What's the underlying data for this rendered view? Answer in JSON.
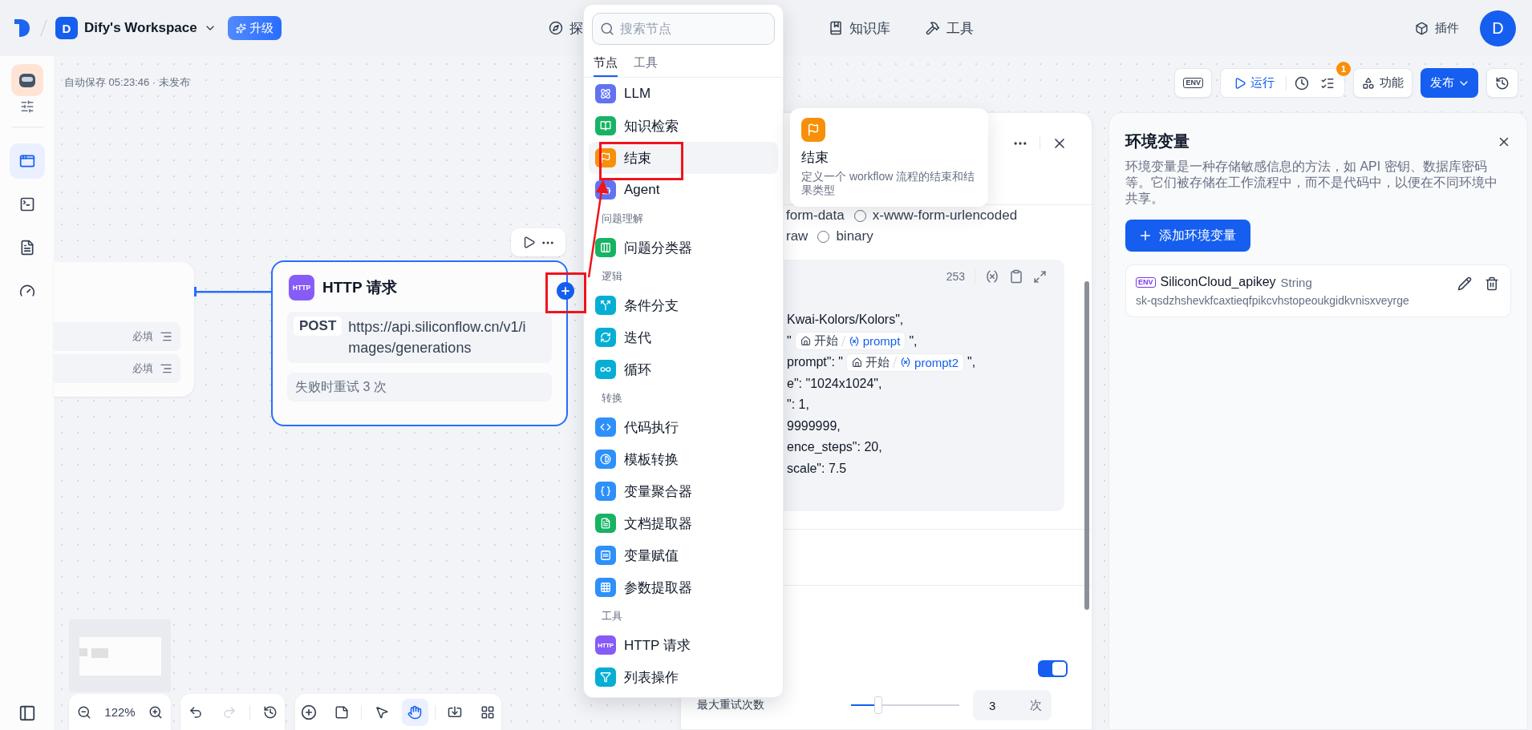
{
  "top_bar": {
    "workspace_initial": "D",
    "workspace_name": "Dify's Workspace",
    "upgrade_label": "升级",
    "nav": [
      {
        "label": "探"
      },
      {
        "label": "知识库"
      },
      {
        "label": "工具"
      }
    ],
    "plugins_label": "插件",
    "avatar_initial": "D"
  },
  "sidebar": {
    "items": [
      {
        "selected": true
      },
      {
        "selected": false
      },
      {
        "selected": false
      },
      {
        "selected": false
      }
    ]
  },
  "canvas": {
    "save_status": "自动保存 05:23:46 · 未发布",
    "toolbar": {
      "env_label": "ENV",
      "run_label": "运行",
      "checklist_badge": "1",
      "features_label": "功能",
      "publish_label": "发布"
    },
    "start_node": {
      "rows": [
        {
          "tag": "必填"
        },
        {
          "tag": "必填"
        }
      ]
    },
    "http_node": {
      "icon_text": "HTTP",
      "title": "HTTP 请求",
      "method": "POST",
      "url": "https://api.siliconflow.cn/v1/images/generations",
      "retry": "失败时重试 3 次",
      "selected": true
    },
    "zoom_level": "122%",
    "redo_disabled": true,
    "tools": [
      {
        "kind": "pointer",
        "selected": false
      },
      {
        "kind": "hand",
        "selected": true
      }
    ]
  },
  "node_panel": {
    "body_options": [
      {
        "label": "form-data"
      },
      {
        "label": "x-www-form-urlencoded",
        "selected": false
      },
      {
        "label": "raw"
      },
      {
        "label": "binary",
        "selected": false
      }
    ],
    "char_count": "253",
    "code_lines": [
      [
        {
          "kind": "text",
          "text": "Kwai-Kolors/Kolors\","
        }
      ],
      [
        {
          "kind": "text",
          "text": "\""
        },
        {
          "kind": "var",
          "node": "开始",
          "name": "prompt"
        },
        {
          "kind": "text",
          "text": "\","
        }
      ],
      [
        {
          "kind": "text",
          "text": "prompt\": \""
        },
        {
          "kind": "var",
          "node": "开始",
          "name": "prompt2"
        },
        {
          "kind": "text",
          "text": "\","
        }
      ],
      [
        {
          "kind": "text",
          "text": "e\": \"1024x1024\","
        }
      ],
      [
        {
          "kind": "text",
          "text": "\": 1,"
        }
      ],
      [
        {
          "kind": "text",
          "text": "9999999,"
        }
      ],
      [
        {
          "kind": "text",
          "text": "ence_steps\": 20,"
        }
      ],
      [
        {
          "kind": "text",
          "text": "scale\": 7.5"
        }
      ]
    ],
    "retry_enabled": true,
    "max_retries_label": "最大重试次数",
    "max_retries": {
      "level": 0.25,
      "value": "3",
      "unit": "次"
    }
  },
  "env_panel": {
    "title": "环境变量",
    "description": "环境变量是一种存储敏感信息的方法，如 API 密钥、数据库密码等。它们被存储在工作流程中，而不是代码中，以便在不同环境中共享。",
    "add_label": "添加环境变量",
    "variables": [
      {
        "icon_text": "ENV",
        "name": "SiliconCloud_apikey",
        "type": "String",
        "value": "sk-qsdzhshevkfcaxtieqfpikcvhstopeoukgidkvnisxveyrge"
      }
    ]
  },
  "node_menu": {
    "search_placeholder": "搜索节点",
    "tabs": [
      {
        "label": "节点",
        "selected": true
      },
      {
        "label": "工具",
        "selected": false
      }
    ],
    "entries": [
      {
        "kind": "item",
        "label": "LLM",
        "color": "#6172f3",
        "selected": false
      },
      {
        "kind": "item",
        "label": "知识检索",
        "color": "#16b364",
        "selected": false
      },
      {
        "kind": "item",
        "label": "结束",
        "color": "#f79009",
        "selected": true
      },
      {
        "kind": "item",
        "label": "Agent",
        "color": "#6172f3",
        "selected": false
      },
      {
        "kind": "section",
        "label": "问题理解"
      },
      {
        "kind": "item",
        "label": "问题分类器",
        "color": "#16b364",
        "selected": false
      },
      {
        "kind": "section",
        "label": "逻辑"
      },
      {
        "kind": "item",
        "label": "条件分支",
        "color": "#06aed4",
        "selected": false
      },
      {
        "kind": "item",
        "label": "迭代",
        "color": "#06aed4",
        "selected": false
      },
      {
        "kind": "item",
        "label": "循环",
        "color": "#06aed4",
        "selected": false
      },
      {
        "kind": "section",
        "label": "转换"
      },
      {
        "kind": "item",
        "label": "代码执行",
        "color": "#2e90fa",
        "selected": false
      },
      {
        "kind": "item",
        "label": "模板转换",
        "color": "#2e90fa",
        "selected": false
      },
      {
        "kind": "item",
        "label": "变量聚合器",
        "color": "#2e90fa",
        "selected": false
      },
      {
        "kind": "item",
        "label": "文档提取器",
        "color": "#16b364",
        "selected": false
      },
      {
        "kind": "item",
        "label": "变量赋值",
        "color": "#2e90fa",
        "selected": false
      },
      {
        "kind": "item",
        "label": "参数提取器",
        "color": "#2e90fa",
        "selected": false
      },
      {
        "kind": "section",
        "label": "工具"
      },
      {
        "kind": "item",
        "label": "HTTP 请求",
        "color": "#875bf7",
        "selected": false,
        "icon_text": "HTTP"
      },
      {
        "kind": "item",
        "label": "列表操作",
        "color": "#06aed4",
        "selected": false
      }
    ]
  },
  "tooltip": {
    "title": "结束",
    "description": "定义一个 workflow 流程的结束和结果类型"
  }
}
